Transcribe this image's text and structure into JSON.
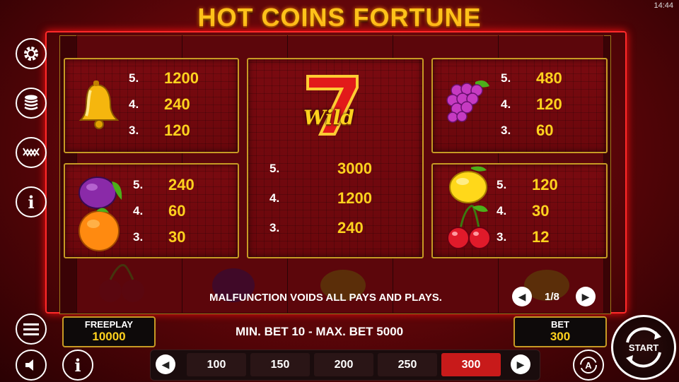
{
  "clock": "14:44",
  "title": "HOT COINS FORTUNE",
  "paytable": {
    "bell": [
      {
        "n": "5.",
        "v": "1200"
      },
      {
        "n": "4.",
        "v": "240"
      },
      {
        "n": "3.",
        "v": "120"
      }
    ],
    "wild": {
      "label": "Wild",
      "rows": [
        {
          "n": "5.",
          "v": "3000"
        },
        {
          "n": "4.",
          "v": "1200"
        },
        {
          "n": "3.",
          "v": "240"
        }
      ]
    },
    "grapes": [
      {
        "n": "5.",
        "v": "480"
      },
      {
        "n": "4.",
        "v": "120"
      },
      {
        "n": "3.",
        "v": "60"
      }
    ],
    "plum_orange": [
      {
        "n": "5.",
        "v": "240"
      },
      {
        "n": "4.",
        "v": "60"
      },
      {
        "n": "3.",
        "v": "30"
      }
    ],
    "lemon_cherry": [
      {
        "n": "5.",
        "v": "120"
      },
      {
        "n": "4.",
        "v": "30"
      },
      {
        "n": "3.",
        "v": "12"
      }
    ]
  },
  "disclaimer": "MALFUNCTION VOIDS ALL PAYS AND PLAYS.",
  "page_indicator": "1/8",
  "freeplay": {
    "label": "FREEPLAY",
    "value": "10000"
  },
  "bet_limits": "MIN. BET 10 - MAX. BET 5000",
  "bet": {
    "label": "BET",
    "value": "300"
  },
  "bet_options": [
    "100",
    "150",
    "200",
    "250",
    "300"
  ],
  "selected_bet": "300",
  "start_label": "START",
  "colors": {
    "gold": "#ffd21e",
    "frame": "#c79a24",
    "selected": "#c81a1a"
  }
}
